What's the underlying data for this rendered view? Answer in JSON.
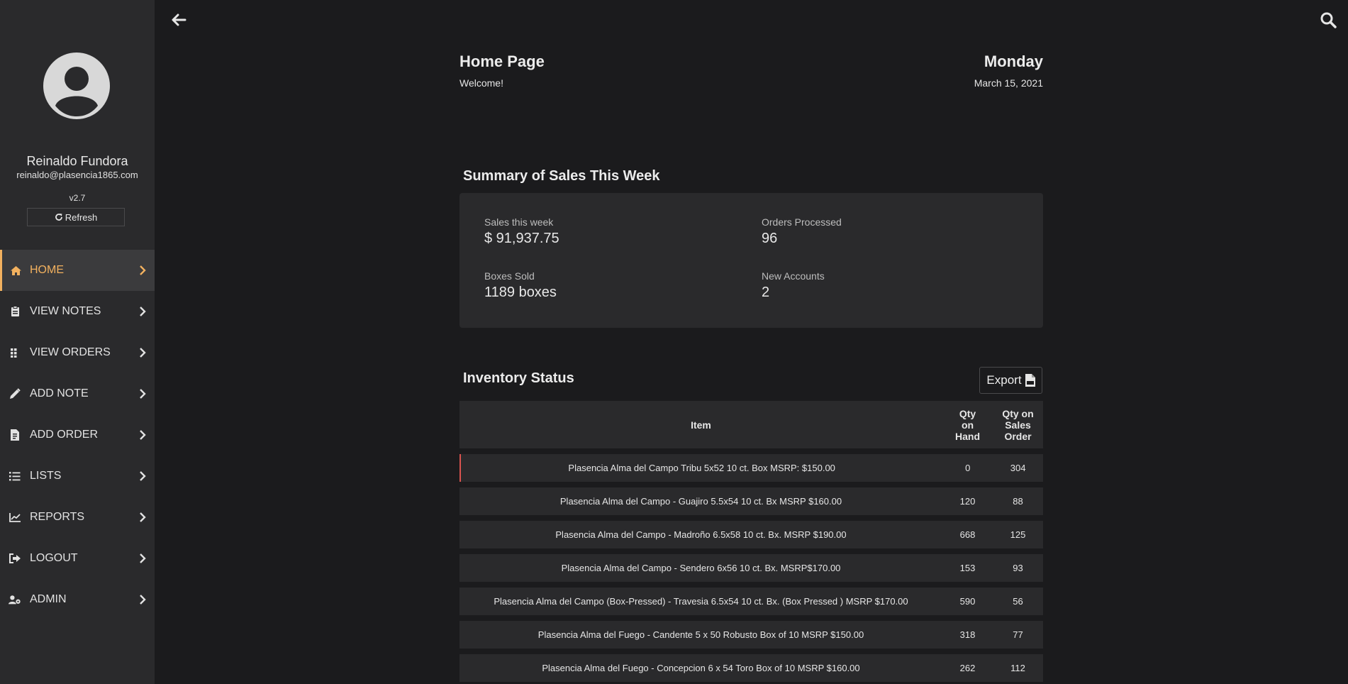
{
  "user": {
    "name": "Reinaldo Fundora",
    "email": "reinaldo@plasencia1865.com",
    "version": "v2.7",
    "refresh_label": "Refresh"
  },
  "nav": {
    "items": [
      {
        "label": "HOME",
        "icon": "home-icon",
        "active": true
      },
      {
        "label": "VIEW NOTES",
        "icon": "clipboard-icon"
      },
      {
        "label": "VIEW ORDERS",
        "icon": "grid-icon"
      },
      {
        "label": "ADD NOTE",
        "icon": "pencil-icon"
      },
      {
        "label": "ADD ORDER",
        "icon": "file-invoice-icon"
      },
      {
        "label": "LISTS",
        "icon": "list-icon"
      },
      {
        "label": "REPORTS",
        "icon": "chart-line-icon"
      },
      {
        "label": "LOGOUT",
        "icon": "sign-out-icon"
      },
      {
        "label": "ADMIN",
        "icon": "user-cog-icon"
      }
    ]
  },
  "header": {
    "title": "Home Page",
    "subtitle": "Welcome!",
    "day": "Monday",
    "date": "March 15, 2021"
  },
  "summary": {
    "title": "Summary of Sales This Week",
    "sales_label": "Sales this week",
    "sales_value": "$ 91,937.75",
    "orders_label": "Orders Processed",
    "orders_value": "96",
    "boxes_label": "Boxes Sold",
    "boxes_value": "1189 boxes",
    "accounts_label": "New Accounts",
    "accounts_value": "2"
  },
  "inventory": {
    "title": "Inventory Status",
    "export_label": "Export",
    "columns": [
      "Item",
      "Qty on Hand",
      "Qty on Sales Order"
    ],
    "col_hand_lines": [
      "Qty",
      "on",
      "Hand"
    ],
    "col_so_lines": [
      "Qty on",
      "Sales",
      "Order"
    ],
    "rows": [
      {
        "item": "Plasencia Alma del Campo Tribu 5x52 10 ct. Box MSRP: $150.00",
        "hand": "0",
        "so": "304"
      },
      {
        "item": "Plasencia Alma del Campo - Guajiro 5.5x54 10 ct. Bx MSRP $160.00",
        "hand": "120",
        "so": "88"
      },
      {
        "item": "Plasencia Alma del Campo - Madroño 6.5x58 10 ct. Bx. MSRP $190.00",
        "hand": "668",
        "so": "125"
      },
      {
        "item": "Plasencia Alma del Campo - Sendero 6x56 10 ct. Bx. MSRP$170.00",
        "hand": "153",
        "so": "93"
      },
      {
        "item": "Plasencia Alma del Campo (Box-Pressed) - Travesia 6.5x54 10 ct. Bx. (Box Pressed ) MSRP $170.00",
        "hand": "590",
        "so": "56"
      },
      {
        "item": "Plasencia Alma del Fuego - Candente 5 x 50 Robusto Box of 10 MSRP $150.00",
        "hand": "318",
        "so": "77"
      },
      {
        "item": "Plasencia Alma del Fuego - Concepcion 6 x 54 Toro Box of 10 MSRP $160.00",
        "hand": "262",
        "so": "112"
      }
    ]
  },
  "colors": {
    "accent": "#f2b15f",
    "flag": "#d9534f",
    "sidebar": "#2a2a2c",
    "background": "#1b1b1d"
  }
}
